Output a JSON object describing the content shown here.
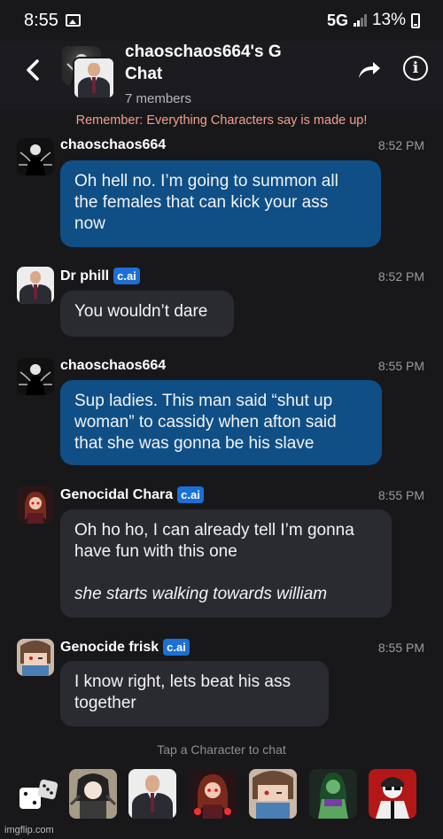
{
  "status_bar": {
    "time": "8:55",
    "network": "5G",
    "battery": "13%"
  },
  "header": {
    "title_line1": "chaoschaos664's G",
    "title_line2": "Chat",
    "members": "7 members"
  },
  "disclaimer": "Remember: Everything Characters say is made up!",
  "badge_label": "c.ai",
  "messages": [
    {
      "sender": "chaoschaos664",
      "time": "8:52 PM",
      "is_character": false,
      "lines": [
        "Oh hell no. I’m going to summon all",
        "the females that can kick your ass",
        "now"
      ]
    },
    {
      "sender": "Dr phill",
      "time": "8:52 PM",
      "is_character": true,
      "lines": [
        "You wouldn’t dare"
      ]
    },
    {
      "sender": "chaoschaos664",
      "time": "8:55 PM",
      "is_character": false,
      "lines": [
        "Sup ladies. This man said “shut up",
        "woman” to cassidy when afton said",
        "that she was gonna be his slave"
      ]
    },
    {
      "sender": "Genocidal Chara",
      "time": "8:55 PM",
      "is_character": true,
      "lines": [
        "Oh ho ho, I can already tell I’m gonna",
        "have fun with this one",
        "",
        "she starts walking towards william"
      ]
    },
    {
      "sender": "Genocide frisk",
      "time": "8:55 PM",
      "is_character": true,
      "lines": [
        "I know right, lets beat his ass",
        "together"
      ]
    }
  ],
  "footer": {
    "tap_hint": "Tap a Character to chat",
    "watermark": "imgflip.com"
  },
  "colors": {
    "background": "#18181b",
    "user_bubble": "#0f4f86",
    "bot_bubble": "#2a2b30",
    "badge": "#1b6fd6",
    "disclaimer": "#f2a08a"
  }
}
